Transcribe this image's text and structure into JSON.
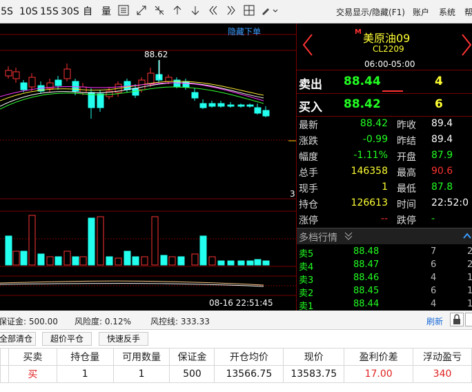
{
  "toolbar": {
    "periods": [
      "5S",
      "10S",
      "15S",
      "30S"
    ],
    "zi": "自",
    "liang": "量",
    "right": [
      "交易显示/隐藏(F1)",
      "账户",
      "系统",
      "帮"
    ]
  },
  "chart": {
    "hide_orders_label": "隐藏下单",
    "high_label": "88.62",
    "axis_mark": "3",
    "timestamp": "08-16 22:51:45"
  },
  "quote": {
    "name": "美原油09",
    "code": "CL2209",
    "session": "06:00-05:00",
    "sell_label": "卖出",
    "sell_price": "88.44",
    "sell_qty": "4",
    "buy_label": "买入",
    "buy_price": "88.42",
    "buy_qty": "6",
    "rows": [
      {
        "l1": "最新",
        "v1": "88.42",
        "c1": "#22ff22",
        "l2": "昨收",
        "v2": "89.4",
        "c2": "#ffffff"
      },
      {
        "l1": "涨跌",
        "v1": "-0.99",
        "c1": "#22ff22",
        "l2": "昨结",
        "v2": "89.4",
        "c2": "#ffffff"
      },
      {
        "l1": "幅度",
        "v1": "-1.11%",
        "c1": "#22ff22",
        "l2": "开盘",
        "v2": "87.9",
        "c2": "#22ff22"
      },
      {
        "l1": "总手",
        "v1": "146358",
        "c1": "#ffff33",
        "l2": "最高",
        "v2": "90.6",
        "c2": "#ff3333"
      },
      {
        "l1": "现手",
        "v1": "1",
        "c1": "#ffff33",
        "l2": "最低",
        "v2": "87.8",
        "c2": "#22ff22"
      },
      {
        "l1": "持仓",
        "v1": "126613",
        "c1": "#ffff33",
        "l2": "时间",
        "v2": "22:52:0",
        "c2": "#ffffff"
      },
      {
        "l1": "涨停",
        "v1": "--",
        "c1": "#ff3333",
        "l2": "跌停",
        "v2": "-",
        "c2": "#22ff22"
      }
    ],
    "depth_title": "多档行情",
    "depth": [
      {
        "label": "卖5",
        "price": "88.48",
        "qty": "7",
        "extra": "2"
      },
      {
        "label": "卖4",
        "price": "88.47",
        "qty": "6",
        "extra": "2"
      },
      {
        "label": "卖3",
        "price": "88.46",
        "qty": "4",
        "extra": "1"
      },
      {
        "label": "卖2",
        "price": "88.45",
        "qty": "6",
        "extra": "1"
      },
      {
        "label": "卖1",
        "price": "88.44",
        "qty": "4",
        "extra": "1"
      }
    ]
  },
  "account": {
    "margin": "保证金: 500.00",
    "risk": "风险度: 0.12%",
    "stop": "风控线: 333.33",
    "refresh": "刷新"
  },
  "actions": [
    "全部清仓",
    "超价平仓",
    "快速反手"
  ],
  "positions": {
    "headers": [
      "",
      "买卖",
      "持仓量",
      "可用数量",
      "保证金",
      "开仓均价",
      "现价",
      "盈利价差",
      "浮动盈亏"
    ],
    "row": [
      "",
      "买",
      "1",
      "1",
      "500",
      "13566.75",
      "13583.75",
      "17.00",
      "340"
    ]
  },
  "colors": {
    "up": "#ff3333",
    "down": "#22ffee",
    "gold": "#ffcc00"
  }
}
